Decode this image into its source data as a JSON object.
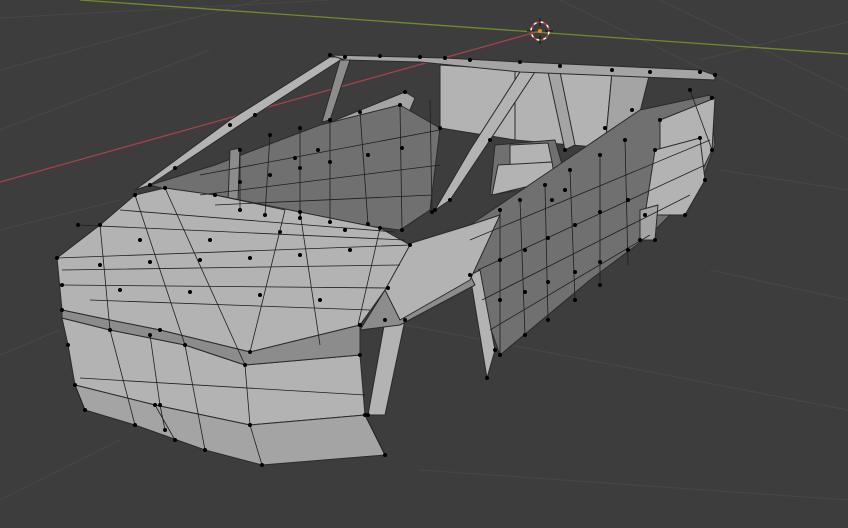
{
  "viewport": {
    "mode": "edit-mode",
    "background": "#3d3d3d",
    "grid_color": "#474747",
    "x_axis_color": "#a3424a",
    "y_axis_color": "#6f8b2e",
    "mesh_face_color": "#a4a4a4",
    "vertex_color": "#000000",
    "cursor_icon": "3d-cursor-icon"
  }
}
